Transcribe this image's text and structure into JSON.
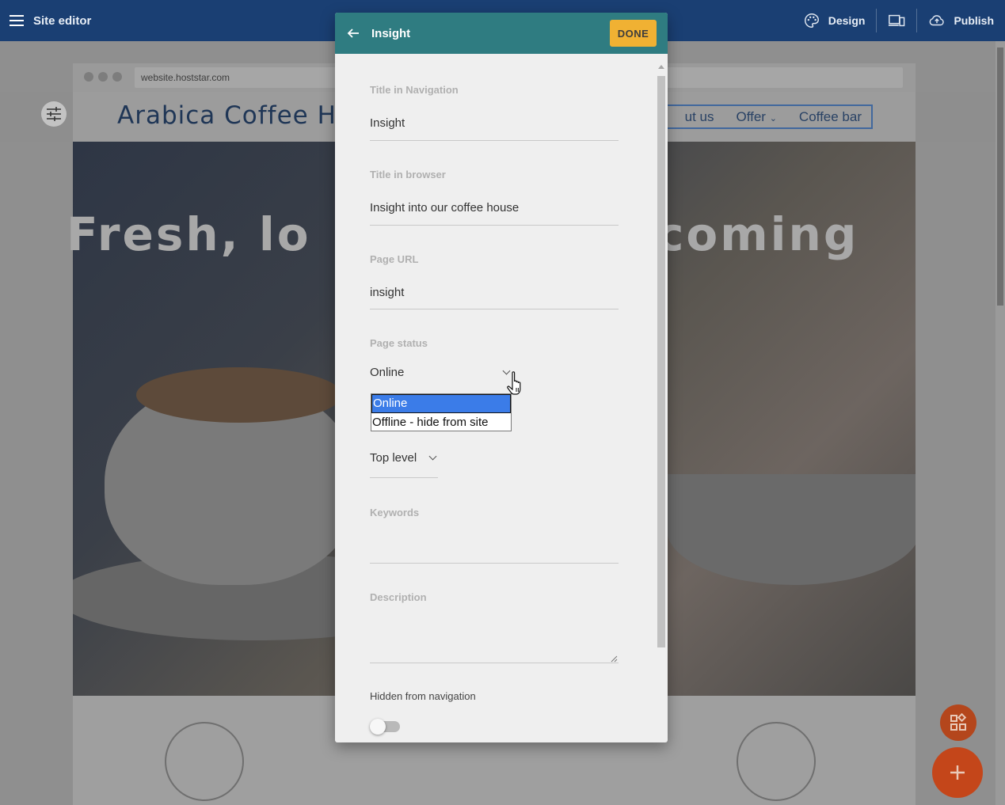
{
  "topbar": {
    "title": "Site editor",
    "design_label": "Design",
    "publish_label": "Publish"
  },
  "canvas": {
    "url": "website.hoststar.com",
    "site_logo": "Arabica Coffee H",
    "nav": [
      "ut us",
      "Offer",
      "Coffee bar"
    ],
    "hero_left": "Fresh, lo",
    "hero_right": "coming"
  },
  "dialog": {
    "title": "Insight",
    "done_label": "DONE",
    "fields": {
      "nav_title_label": "Title in Navigation",
      "nav_title_value": "Insight",
      "browser_title_label": "Title in browser",
      "browser_title_value": "Insight into our coffee house",
      "url_label": "Page URL",
      "url_value": "insight",
      "status_label": "Page status",
      "status_value": "Online",
      "parent_value": "Top level",
      "keywords_label": "Keywords",
      "description_label": "Description",
      "hidden_label": "Hidden from navigation"
    },
    "status_options": [
      "Online",
      "Offline - hide from site"
    ],
    "hidden_from_navigation": false
  },
  "colors": {
    "topbar": "#1a3f73",
    "dialog_header": "#2f7c81",
    "done_button": "#f0b133",
    "fab": "#c4461a",
    "selected_option": "#3b7ce8"
  }
}
